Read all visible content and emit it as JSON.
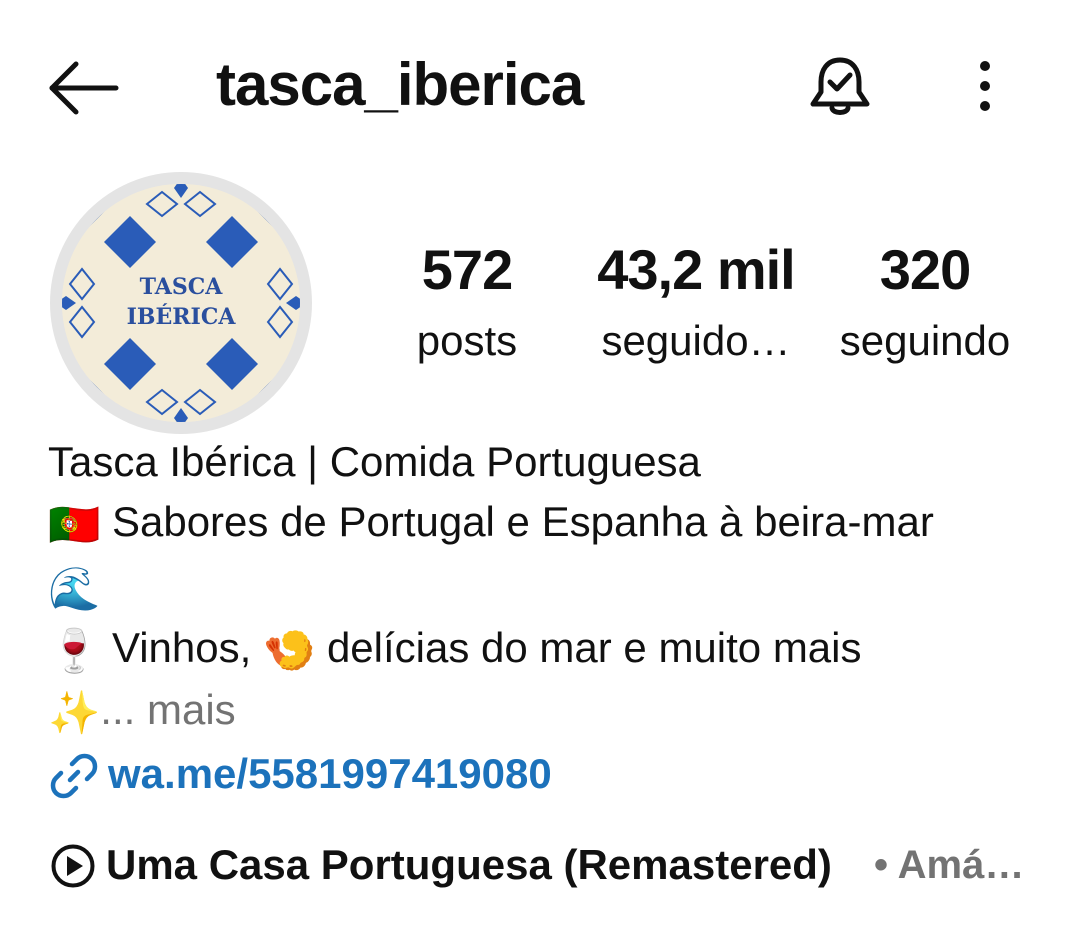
{
  "header": {
    "back_icon": "arrow-left-icon",
    "username": "tasca_iberica",
    "notification_icon": "bell-check-icon",
    "more_icon": "vertical-dots-icon"
  },
  "avatar": {
    "logo_text_line1": "TASCA",
    "logo_text_line2": "IBÉRICA",
    "tile_color": "#2a5cb8",
    "background_color": "#f3ecd9"
  },
  "stats": [
    {
      "value": "572",
      "label": "posts"
    },
    {
      "value": "43,2 mil",
      "label": "seguido…"
    },
    {
      "value": "320",
      "label": "seguindo"
    }
  ],
  "bio": {
    "name": "Tasca Ibérica | Comida Portuguesa",
    "line1_emoji": "🇵🇹",
    "line1_text": "Sabores de Portugal e Espanha à beira-mar",
    "line2_emoji": "🌊",
    "line3_emoji1": "🍷",
    "line3_text1": "Vinhos,",
    "line3_emoji2": "🍤",
    "line3_text2": "delícias do mar e muito mais",
    "line4_emoji": "✨",
    "more_label": "... mais"
  },
  "link": {
    "icon": "link-icon",
    "text": "wa.me/5581997419080",
    "color": "#1c72bb"
  },
  "music": {
    "icon": "play-circle-icon",
    "title": "Uma Casa Portuguesa (Remastered)",
    "artist": "• Amá…"
  }
}
